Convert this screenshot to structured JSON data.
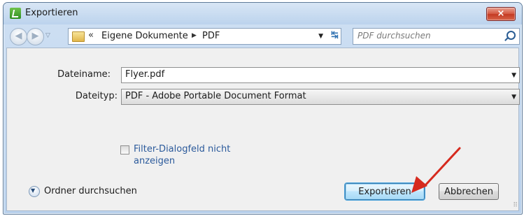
{
  "window": {
    "title": "Exportieren",
    "close_label": "×"
  },
  "nav": {
    "back_glyph": "◀",
    "forward_glyph": "▶",
    "history_glyph": "▽",
    "breadcrumb_prefix": "«",
    "breadcrumb": [
      "Eigene Dokumente",
      "PDF"
    ],
    "breadcrumb_separator": "▶",
    "dropdown_glyph": "▼",
    "refresh_glyph": "↹",
    "search_placeholder": "PDF durchsuchen"
  },
  "form": {
    "filename_label": "Dateiname:",
    "filename_value": "Flyer.pdf",
    "filetype_label": "Dateityp:",
    "filetype_value": "PDF - Adobe Portable Document Format",
    "checkbox_label": "Filter-Dialogfeld nicht anzeigen",
    "checkbox_checked": false
  },
  "footer": {
    "browse_glyph": "▼",
    "browse_label": "Ordner durchsuchen",
    "export_button": "Exportieren",
    "cancel_button": "Abbrechen"
  },
  "annotation": {
    "arrow_color": "#d62a1e"
  },
  "icons": [
    "app-icon",
    "close-icon",
    "back-icon",
    "forward-icon",
    "folder-icon",
    "refresh-icon",
    "search-icon",
    "expand-icon",
    "resize-grip-icon"
  ]
}
